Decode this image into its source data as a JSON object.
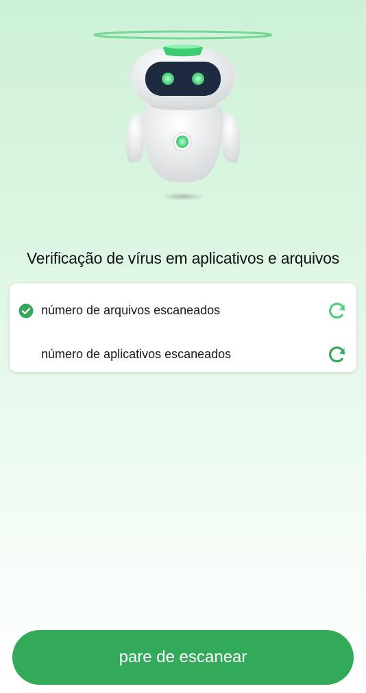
{
  "header": {
    "title": "Verificação de vírus em aplicativos e arquivos"
  },
  "scan_items": [
    {
      "label": "número de arquivos escaneados",
      "done": true,
      "icon": "refresh-icon"
    },
    {
      "label": "número de aplicativos escaneados",
      "done": false,
      "icon": "refresh-icon"
    }
  ],
  "actions": {
    "stop_label": "pare de escanear"
  },
  "colors": {
    "accent": "#33a95a",
    "accent_light": "#4cd07a"
  }
}
